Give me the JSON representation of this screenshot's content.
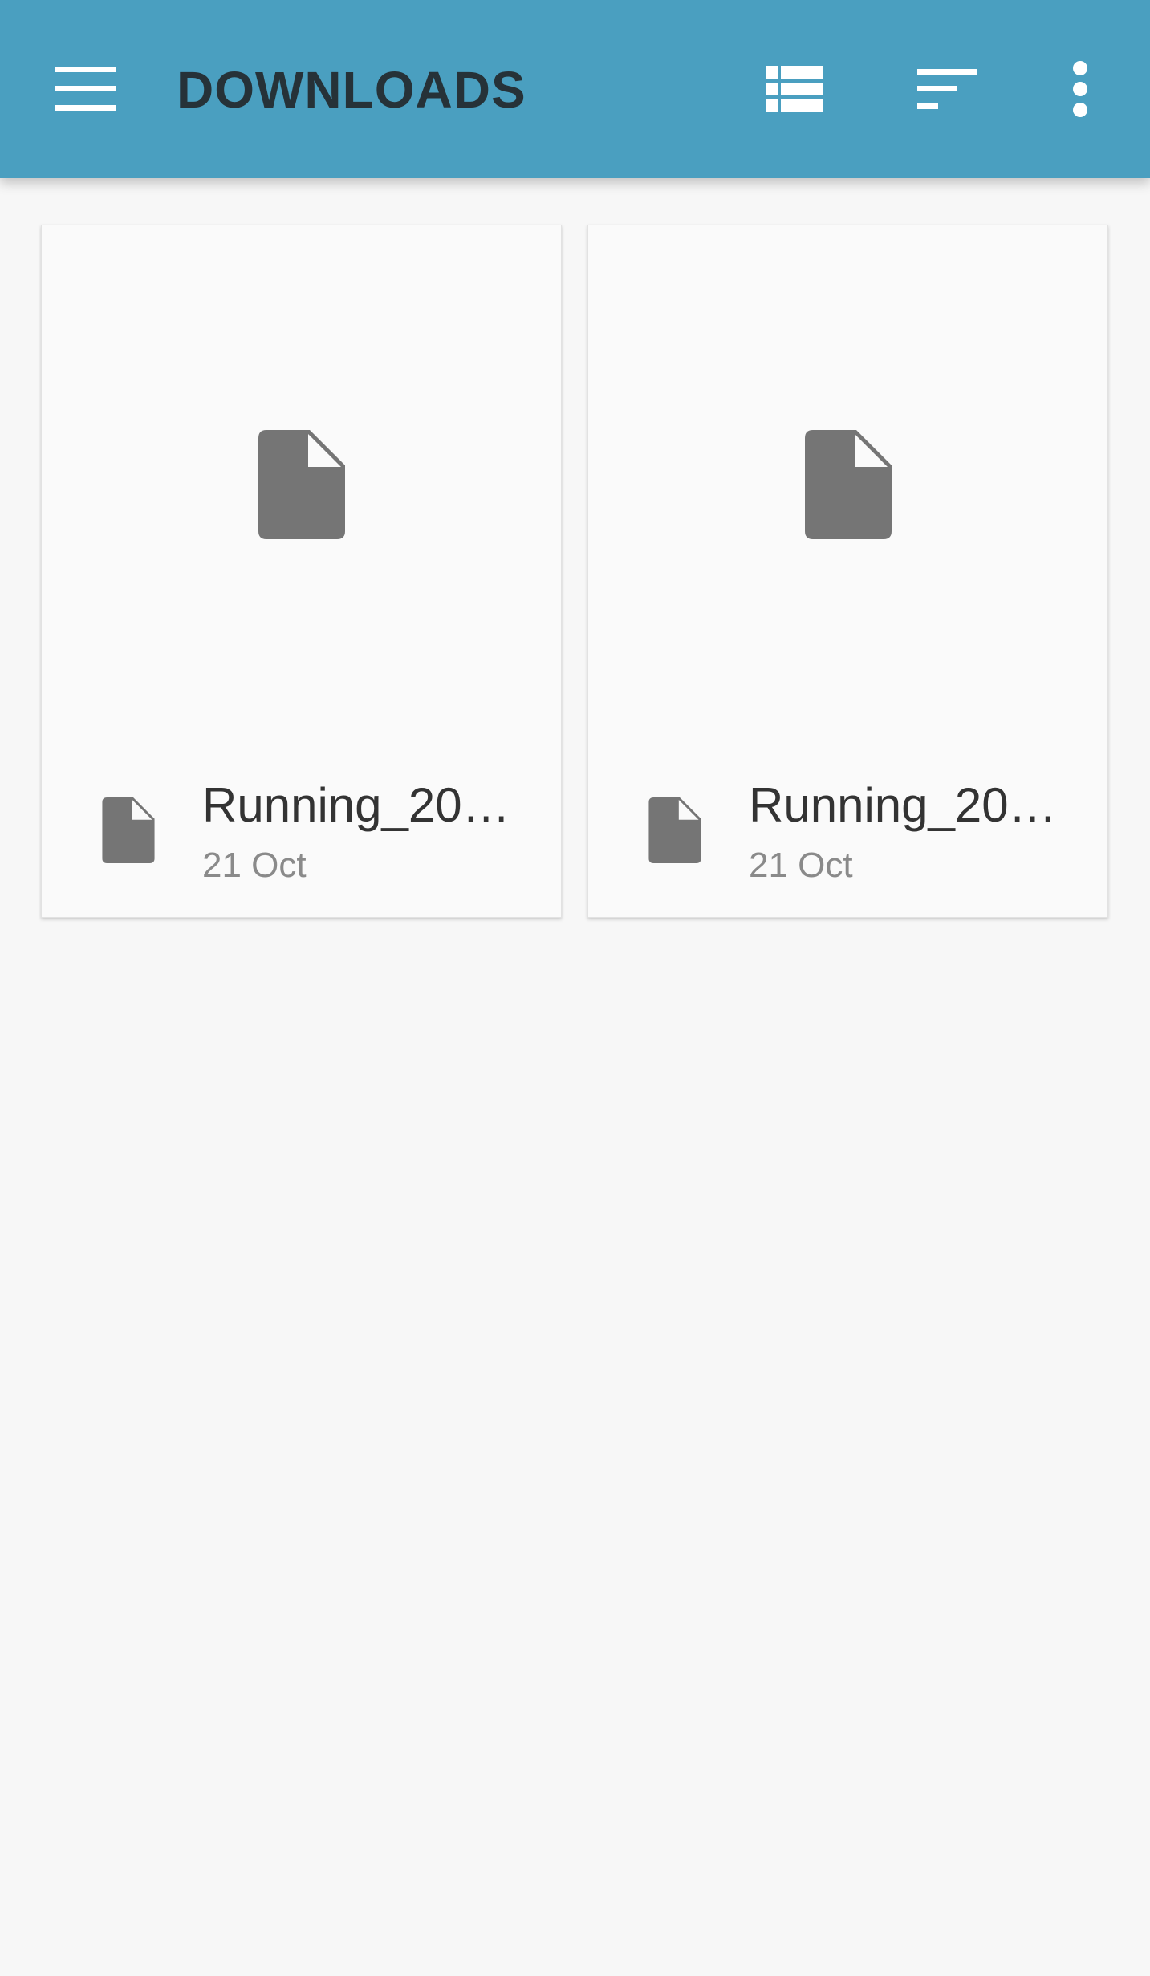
{
  "app_bar": {
    "title": "DOWNLOADS",
    "icons": {
      "menu": "hamburger-menu-icon",
      "view": "list-view-icon",
      "sort": "sort-icon",
      "more": "more-vert-icon"
    },
    "background_color": "#4a9fc0",
    "title_color": "#263238"
  },
  "files": [
    {
      "name": "Running_20…",
      "date": "21 Oct",
      "icon": "file-icon"
    },
    {
      "name": "Running_20…",
      "date": "21 Oct",
      "icon": "file-icon"
    }
  ],
  "colors": {
    "icon": "#757575",
    "background": "#f7f7f7",
    "card": "#fafafa"
  }
}
